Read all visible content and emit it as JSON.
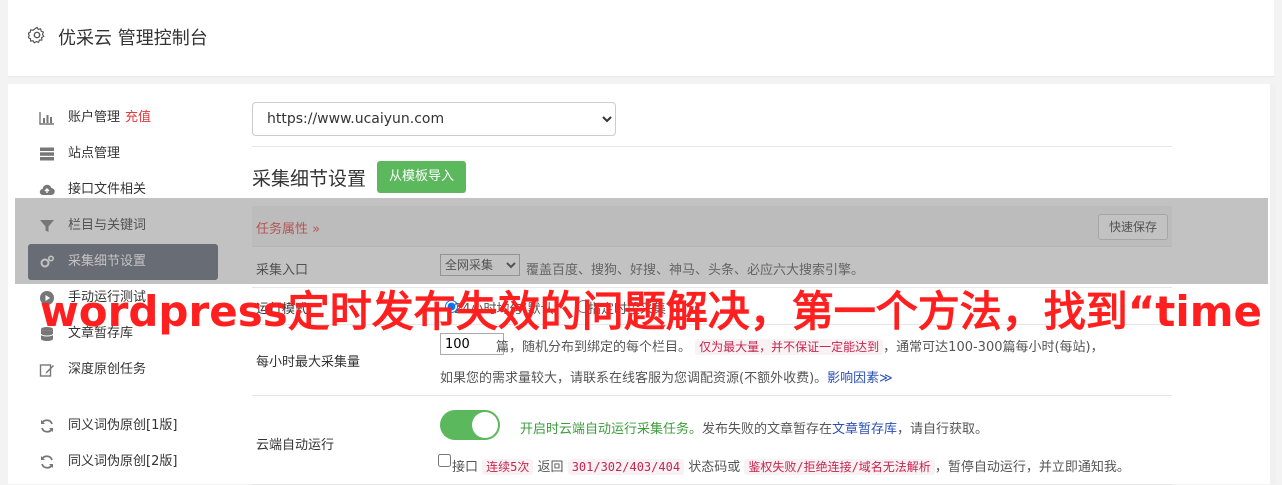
{
  "header": {
    "title": "优采云 管理控制台"
  },
  "sidebar": {
    "items": [
      {
        "label": "账户管理",
        "badge": "充值",
        "icon": "bar-chart-icon"
      },
      {
        "label": "站点管理",
        "icon": "server-icon"
      },
      {
        "label": "接口文件相关",
        "icon": "cloud-upload-icon"
      },
      {
        "label": "栏目与关键词",
        "icon": "filter-icon"
      },
      {
        "label": "采集细节设置",
        "icon": "gears-icon",
        "active": true
      },
      {
        "label": "手动运行测试",
        "icon": "play-icon"
      },
      {
        "label": "文章暂存库",
        "icon": "database-icon"
      },
      {
        "label": "深度原创任务",
        "icon": "edit-icon"
      },
      {
        "label": "同义词伪原创[1版]",
        "icon": "refresh-icon"
      },
      {
        "label": "同义词伪原创[2版]",
        "icon": "refresh-icon"
      }
    ]
  },
  "main": {
    "site_select": "https://www.ucaiyun.com",
    "section_title": "采集细节设置",
    "import_button": "从模板导入",
    "tab_label": "任务属性",
    "quick_save": "快速保存",
    "entry": {
      "label": "采集入口",
      "select_value": "全网采集",
      "desc": "覆盖百度、搜狗、好搜、神马、头条、必应六大搜索引擎。"
    },
    "run_mode": {
      "label": "运行模式",
      "option1": "24小时均匀(默认)",
      "option2": "指定时段采集"
    },
    "max": {
      "label": "每小时最大采集量",
      "value": "100",
      "text_a": "篇，随机分布到绑定的每个栏目。",
      "code_a": "仅为最大量，并不保证一定能达到",
      "text_b": "，通常可达100-300篇每小时(每站)，",
      "text_c": "如果您的需求量较大，请联系在线客服为您调配资源(不额外收费)。",
      "link": "影响因素"
    },
    "cloud": {
      "label": "云端自动运行",
      "green_text": "开启时云端自动运行采集任务。",
      "text_a": "发布失败的文章暂存在",
      "link": "文章暂存库",
      "text_b": "，请自行获取。",
      "cb_a": "接口",
      "code_a": "连续5次",
      "cb_b": "返回",
      "code_b": "301/302/403/404",
      "cb_c": "状态码或",
      "code_c": "鉴权失败/拒绝连接/域名无法解析",
      "cb_d": "，暂停自动运行，并立即通知我。"
    }
  },
  "overlay": {
    "text": "wordpress定时发布失效的问题解决，第一个方法，找到“time"
  },
  "colors": {
    "accent_red": "#e4393c",
    "green": "#5cb85c",
    "sidebar_active": "#5a6373",
    "overlay_text": "#ff1f1f"
  }
}
